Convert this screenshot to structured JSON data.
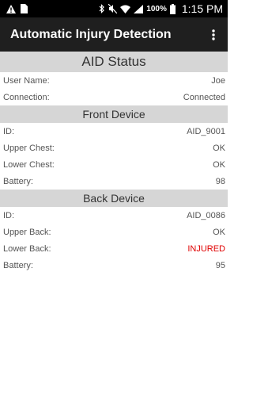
{
  "status_bar": {
    "battery_percent": "100%",
    "time": "1:15 PM",
    "icons": [
      "warning-icon",
      "sim-card-icon",
      "bluetooth-icon",
      "mute-icon",
      "wifi-icon",
      "signal-icon",
      "battery-icon"
    ]
  },
  "app_bar": {
    "title": "Automatic Injury Detection",
    "menu_icon": "overflow-menu-icon"
  },
  "status": {
    "header": "AID Status",
    "rows": [
      {
        "label": "User Name:",
        "value": "Joe"
      },
      {
        "label": "Connection:",
        "value": "Connected"
      }
    ]
  },
  "front": {
    "header": "Front Device",
    "rows": [
      {
        "label": "ID:",
        "value": "AID_9001"
      },
      {
        "label": "Upper Chest:",
        "value": "OK"
      },
      {
        "label": "Lower Chest:",
        "value": "OK"
      },
      {
        "label": "Battery:",
        "value": "98"
      }
    ]
  },
  "back": {
    "header": "Back Device",
    "rows": [
      {
        "label": "ID:",
        "value": "AID_0086"
      },
      {
        "label": "Upper Back:",
        "value": "OK"
      },
      {
        "label": "Lower Back:",
        "value": "INJURED"
      },
      {
        "label": "Battery:",
        "value": "95"
      }
    ]
  },
  "colors": {
    "injured": "#e00000",
    "header_bg": "#d6d6d6",
    "app_bar_bg": "#1f1f1f"
  }
}
